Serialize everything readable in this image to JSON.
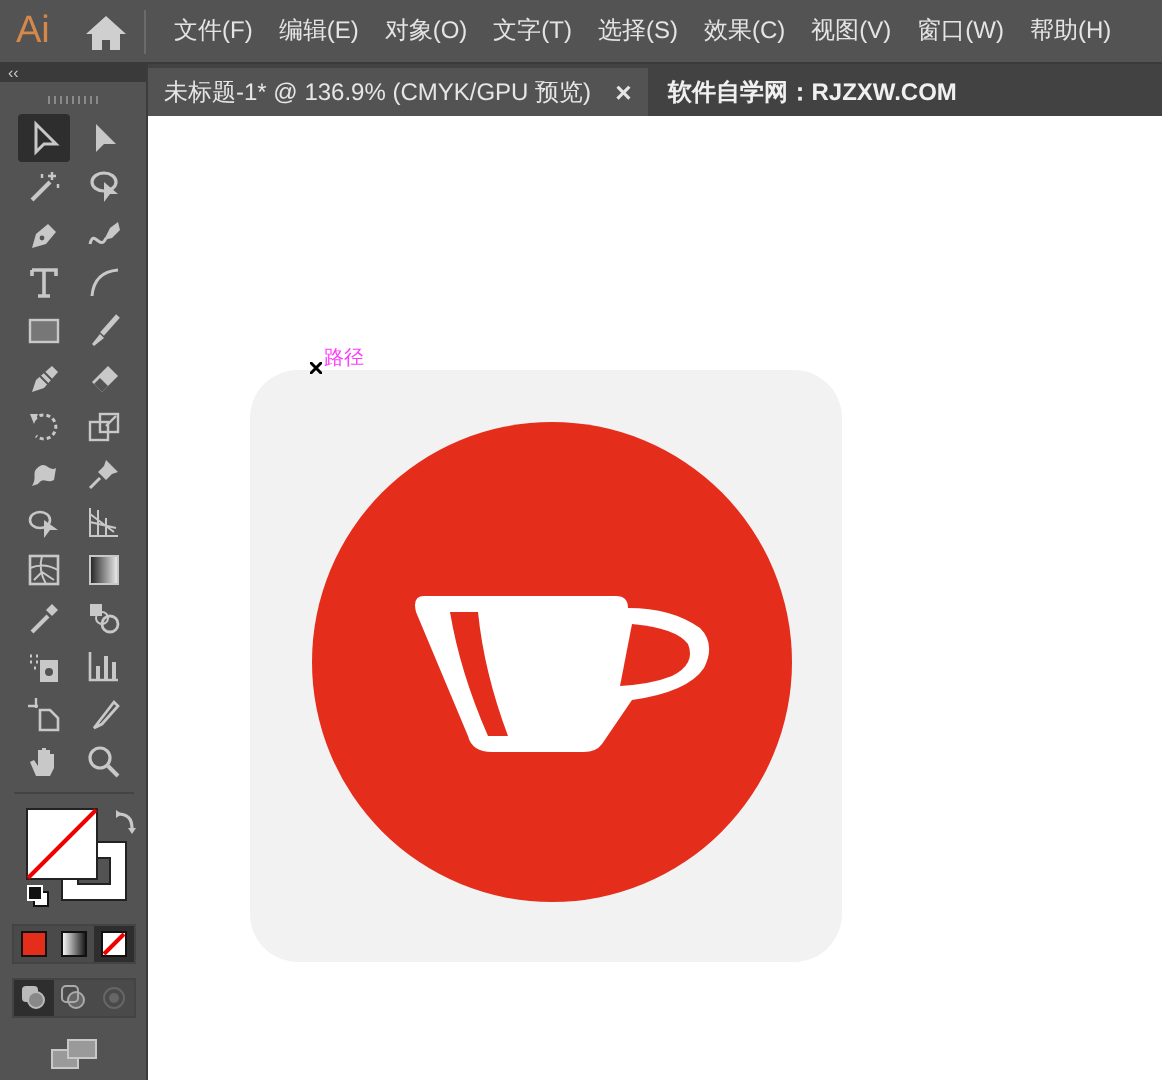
{
  "app": {
    "logo": "Ai"
  },
  "menu": [
    "文件(F)",
    "编辑(E)",
    "对象(O)",
    "文字(T)",
    "选择(S)",
    "效果(C)",
    "视图(V)",
    "窗口(W)",
    "帮助(H)"
  ],
  "toolbar": {
    "collapse": "‹‹"
  },
  "tabs": [
    {
      "label": "未标题-1* @ 136.9% (CMYK/GPU 预览)",
      "close": "×",
      "selected": true
    },
    {
      "label": "软件自学网：RJZXW.COM",
      "selected": false
    }
  ],
  "tools": [
    {
      "kind": "select",
      "selected": true
    },
    {
      "kind": "direct",
      "selected": false
    },
    {
      "kind": "wand",
      "selected": false
    },
    {
      "kind": "lasso",
      "selected": false
    },
    {
      "kind": "pen",
      "selected": false
    },
    {
      "kind": "curvature",
      "selected": false
    },
    {
      "kind": "type",
      "selected": false
    },
    {
      "kind": "arc",
      "selected": false
    },
    {
      "kind": "rect",
      "selected": false
    },
    {
      "kind": "brush",
      "selected": false
    },
    {
      "kind": "pencil",
      "selected": false
    },
    {
      "kind": "eraser",
      "selected": false
    },
    {
      "kind": "rotate",
      "selected": false
    },
    {
      "kind": "scale",
      "selected": false
    },
    {
      "kind": "warp",
      "selected": false
    },
    {
      "kind": "pin",
      "selected": false
    },
    {
      "kind": "builder",
      "selected": false
    },
    {
      "kind": "perspective",
      "selected": false
    },
    {
      "kind": "mesh",
      "selected": false
    },
    {
      "kind": "gradient",
      "selected": false
    },
    {
      "kind": "eyedropper",
      "selected": false
    },
    {
      "kind": "blend",
      "selected": false
    },
    {
      "kind": "sprayer",
      "selected": false
    },
    {
      "kind": "graph",
      "selected": false
    },
    {
      "kind": "artboard",
      "selected": false
    },
    {
      "kind": "knife",
      "selected": false
    },
    {
      "kind": "hand",
      "selected": false
    },
    {
      "kind": "zoom",
      "selected": false
    }
  ],
  "color_modes": [
    {
      "kind": "color",
      "selected": false
    },
    {
      "kind": "gradient",
      "selected": false
    },
    {
      "kind": "none",
      "selected": true
    }
  ],
  "draw_modes": [
    {
      "selected": true
    },
    {
      "selected": false
    },
    {
      "selected": false
    }
  ],
  "canvas": {
    "path_label": "路径"
  }
}
